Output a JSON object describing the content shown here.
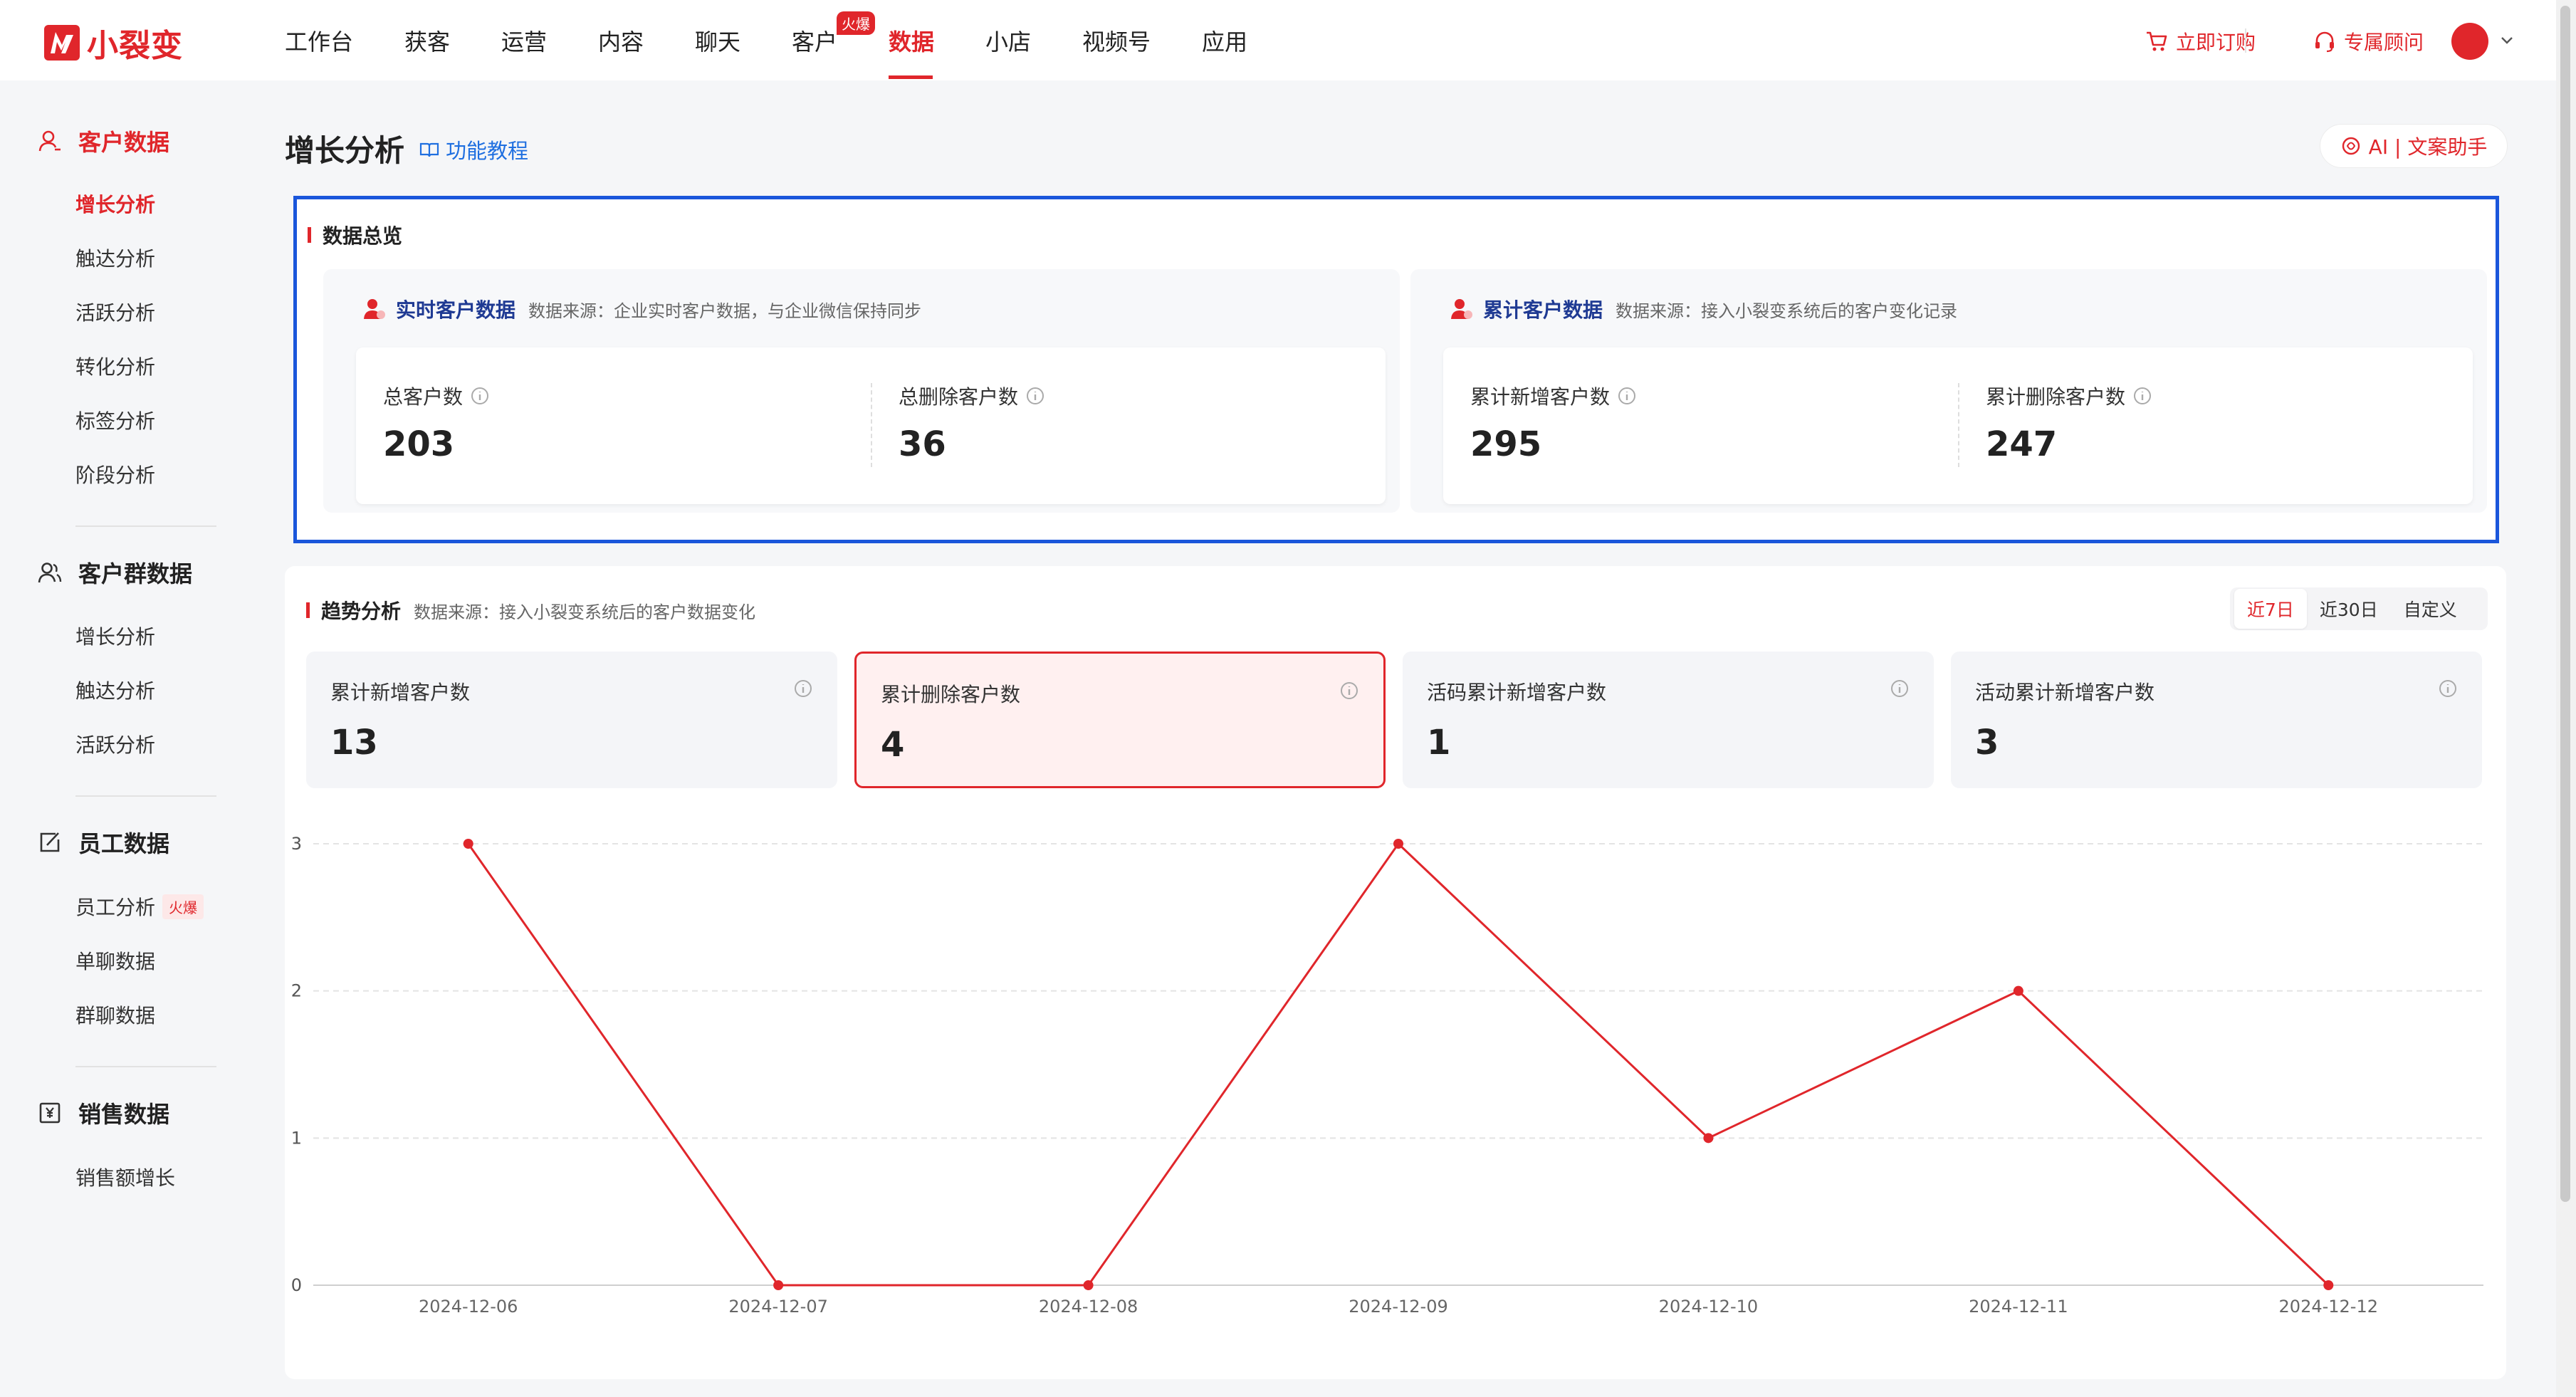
{
  "brand": {
    "name": "小裂变"
  },
  "nav": {
    "items": [
      "工作台",
      "获客",
      "运营",
      "内容",
      "聊天",
      "客户",
      "数据",
      "小店",
      "视频号",
      "应用"
    ],
    "active_index": 6,
    "hot_badge": "火爆"
  },
  "top_actions": {
    "subscribe": "立即订购",
    "consultant": "专属顾问"
  },
  "sidebar": {
    "groups": [
      {
        "title": "客户数据",
        "items": [
          "增长分析",
          "触达分析",
          "活跃分析",
          "转化分析",
          "标签分析",
          "阶段分析"
        ]
      },
      {
        "title": "客户群数据",
        "items": [
          "增长分析",
          "触达分析",
          "活跃分析"
        ]
      },
      {
        "title": "员工数据",
        "items": [
          "员工分析",
          "单聊数据",
          "群聊数据"
        ]
      },
      {
        "title": "销售数据",
        "items": [
          "销售额增长"
        ]
      }
    ],
    "hot_tag": "火爆"
  },
  "page": {
    "title": "增长分析",
    "tutorial": "功能教程",
    "ai_assistant": "AI | 文案助手"
  },
  "overview": {
    "title": "数据总览",
    "realtime": {
      "title": "实时客户数据",
      "source": "数据来源：企业实时客户数据，与企业微信保持同步",
      "metrics": [
        {
          "label": "总客户数",
          "value": "203"
        },
        {
          "label": "总删除客户数",
          "value": "36"
        }
      ]
    },
    "cumulative": {
      "title": "累计客户数据",
      "source": "数据来源：接入小裂变系统后的客户变化记录",
      "metrics": [
        {
          "label": "累计新增客户数",
          "value": "295"
        },
        {
          "label": "累计删除客户数",
          "value": "247"
        }
      ]
    }
  },
  "trend": {
    "title": "趋势分析",
    "source": "数据来源：接入小裂变系统后的客户数据变化",
    "ranges": [
      "近7日",
      "近30日",
      "自定义"
    ],
    "active_range": 0,
    "cards": [
      {
        "label": "累计新增客户数",
        "value": "13"
      },
      {
        "label": "累计删除客户数",
        "value": "4"
      },
      {
        "label": "活码累计新增客户数",
        "value": "1"
      },
      {
        "label": "活动累计新增客户数",
        "value": "3"
      }
    ],
    "selected_card": 1
  },
  "colors": {
    "accent": "#e0262b",
    "highlight_border": "#1a56db",
    "link": "#1f6fe0"
  },
  "chart_data": {
    "type": "line",
    "x": [
      "2024-12-06",
      "2024-12-07",
      "2024-12-08",
      "2024-12-09",
      "2024-12-10",
      "2024-12-11",
      "2024-12-12"
    ],
    "series": [
      {
        "values": [
          3,
          0,
          0,
          3,
          1,
          2,
          0
        ],
        "color": "#e0262b"
      }
    ],
    "ylim": [
      0,
      3
    ],
    "yticks": [
      0,
      1,
      2,
      3
    ],
    "grid": true
  }
}
